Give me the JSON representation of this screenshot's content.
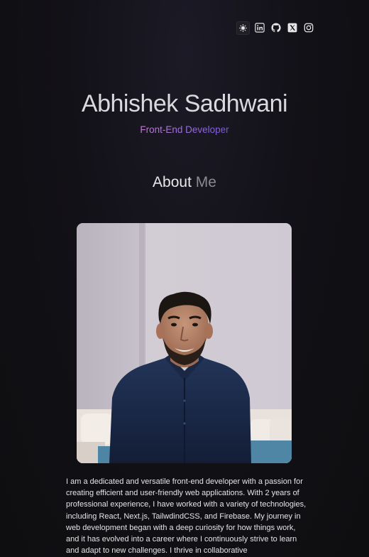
{
  "header": {
    "icons": [
      {
        "name": "theme-toggle",
        "icon": "sun-icon"
      },
      {
        "name": "linkedin",
        "icon": "linkedin-icon"
      },
      {
        "name": "github",
        "icon": "github-icon"
      },
      {
        "name": "x-twitter",
        "icon": "x-icon"
      },
      {
        "name": "instagram",
        "icon": "instagram-icon"
      }
    ]
  },
  "hero": {
    "name": "Abhishek Sadhwani",
    "role": "Front-End Developer"
  },
  "about": {
    "title_main": "About",
    "title_accent": "Me",
    "bio": "I am a dedicated and versatile front-end developer with a passion for creating efficient and user-friendly web applications. With 2 years of professional experience, I have worked with a variety of technologies, including React, Next.js, TailwdindCSS, and Firebase. My journey in web development began with a deep curiosity for how things work, and it has evolved into a career where I continuously strive to learn and adapt to new challenges. I thrive in collaborative"
  },
  "colors": {
    "background": "#0e0e10",
    "name_text": "#d9d9de",
    "role_gradient_start": "#c77ad6",
    "role_gradient_end": "#7a5ad8",
    "muted_accent": "#8a8a92"
  }
}
